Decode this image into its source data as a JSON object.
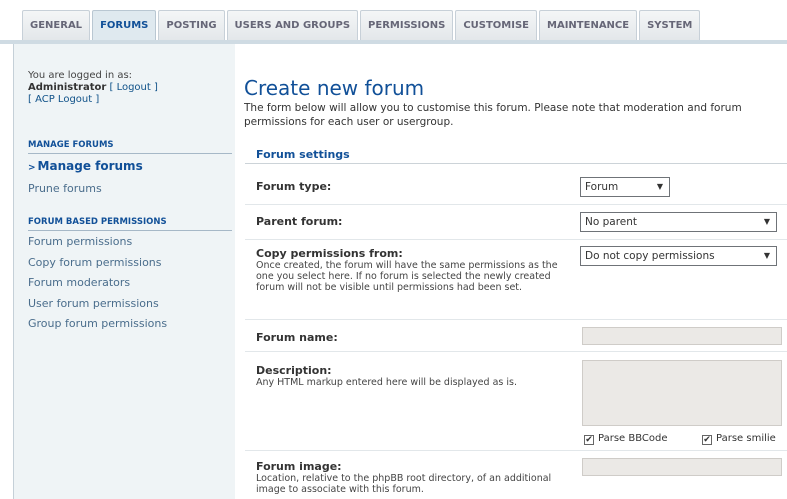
{
  "tabs": [
    "General",
    "Forums",
    "Posting",
    "Users and groups",
    "Permissions",
    "Customise",
    "Maintenance",
    "System"
  ],
  "active_tab": 1,
  "sidebar": {
    "logged_in_as": "You are logged in as:",
    "username": "Administrator",
    "logout": "[ Logout ]",
    "acp_logout": "[ ACP Logout ]",
    "sections": [
      {
        "title": "Manage forums",
        "items": [
          {
            "label": "Manage forums",
            "active": true
          },
          {
            "label": "Prune forums",
            "active": false
          }
        ]
      },
      {
        "title": "Forum based permissions",
        "items": [
          {
            "label": "Forum permissions",
            "active": false
          },
          {
            "label": "Copy forum permissions",
            "active": false
          },
          {
            "label": "Forum moderators",
            "active": false
          },
          {
            "label": "User forum permissions",
            "active": false
          },
          {
            "label": "Group forum permissions",
            "active": false
          }
        ]
      }
    ]
  },
  "main": {
    "title": "Create new forum",
    "intro": "The form below will allow you to customise this forum. Please note that moderation and forum permissions for each user or usergroup.",
    "legend": "Forum settings",
    "forum_type": {
      "label": "Forum type:",
      "value": "Forum"
    },
    "parent_forum": {
      "label": "Parent forum:",
      "value": "No parent"
    },
    "copy_permissions": {
      "label": "Copy permissions from:",
      "desc": "Once created, the forum will have the same permissions as the one you select here. If no forum is selected the newly created forum will not be visible until permissions had been set.",
      "value": "Do not copy permissions"
    },
    "forum_name": {
      "label": "Forum name:",
      "value": ""
    },
    "description": {
      "label": "Description:",
      "desc": "Any HTML markup entered here will be displayed as is.",
      "value": ""
    },
    "parse_bbcode": "Parse BBCode",
    "parse_smilies": "Parse smilie",
    "forum_image": {
      "label": "Forum image:",
      "desc": "Location, relative to the phpBB root directory, of an additional image to associate with this forum.",
      "value": ""
    }
  },
  "colors": {
    "accent": "#115098",
    "sidebar_bg": "#eff4f6",
    "input_bg": "#ebe9e6"
  }
}
